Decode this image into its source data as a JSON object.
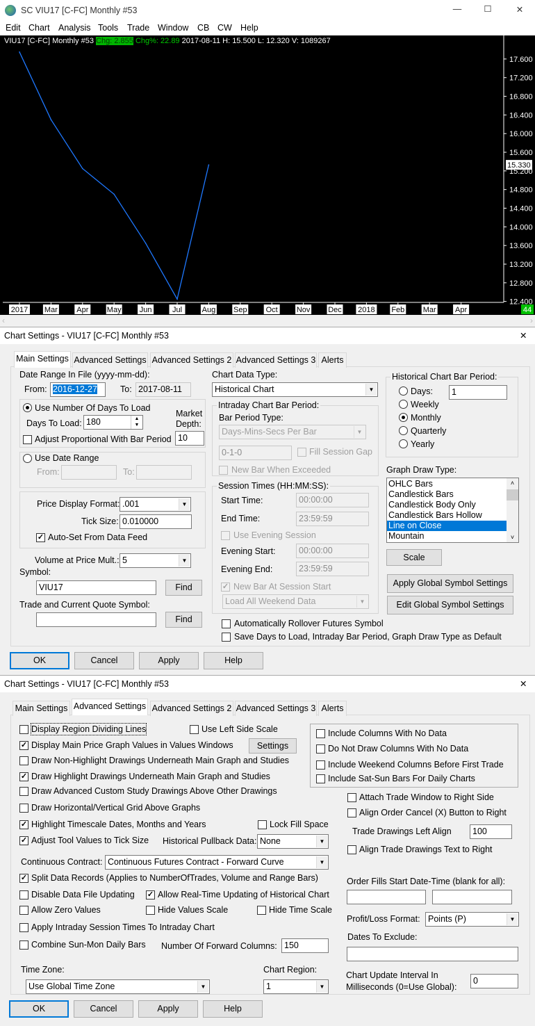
{
  "window": {
    "title": "SC VIU17 [C-FC]  Monthly  #53",
    "min": "—",
    "max": "☐",
    "close": "✕"
  },
  "menu": [
    "Edit",
    "Chart",
    "Analysis",
    "Tools",
    "Trade",
    "Window",
    "CB",
    "CW",
    "Help"
  ],
  "chart_header": {
    "symbol": "VIU17 [C-FC]  Monthly  #53",
    "chg": "Chg: 2.855",
    "chgpct": "Chg%: 22.89",
    "rest": "2017-08-11 H: 15.500 L: 12.320 V: 1089267"
  },
  "chart_data": {
    "type": "line",
    "series_name": "Line on Close",
    "x": [
      "2017",
      "Mar",
      "Apr",
      "May",
      "Jun",
      "Jul",
      "Aug"
    ],
    "values": [
      17.75,
      16.3,
      15.25,
      14.7,
      13.65,
      12.45,
      15.33
    ],
    "x_ticks": [
      "2017",
      "Mar",
      "Apr",
      "May",
      "Jun",
      "Jul",
      "Aug",
      "Sep",
      "Oct",
      "Nov",
      "Dec",
      "2018",
      "Feb",
      "Mar",
      "Apr"
    ],
    "y_ticks": [
      "17.600",
      "17.200",
      "16.800",
      "16.400",
      "16.000",
      "15.600",
      "15.200",
      "14.800",
      "14.400",
      "14.000",
      "13.600",
      "13.200",
      "12.800",
      "12.400"
    ],
    "last_value_label": "15.330",
    "bar_count": "44",
    "ylim": [
      12.38,
      18.09
    ],
    "line_color": "#1e78ff"
  },
  "dialog1": {
    "title": "Chart Settings - VIU17 [C-FC]  Monthly  #53",
    "close": "✕",
    "tabs": [
      "Main Settings",
      "Advanced Settings",
      "Advanced Settings 2",
      "Advanced Settings 3",
      "Alerts"
    ],
    "date_range_label": "Date Range In File (yyyy-mm-dd):",
    "from_label": "From:",
    "from": "2016-12-27",
    "to_label": "To:",
    "to": "2017-08-11",
    "use_days_label": "Use Number Of Days To Load",
    "days_label": "Days To Load:",
    "days": "180",
    "market_depth_label1": "Market",
    "market_depth_label2": "Depth:",
    "market_depth": "10",
    "adjust_prop_label": "Adjust Proportional With Bar Period",
    "use_date_range_label": "Use Date Range",
    "dr_from": "From:",
    "dr_to": "To:",
    "price_format_label": "Price Display Format:",
    "price_format": ".001",
    "tick_size_label": "Tick Size:",
    "tick_size": "0.010000",
    "auto_set_label": "Auto-Set From Data Feed",
    "vap_label": "Volume at Price Mult.:",
    "vap": "5",
    "symbol_label": "Symbol:",
    "symbol": "VIU17",
    "find": "Find",
    "trade_symbol_label": "Trade and Current Quote Symbol:",
    "trade_symbol": "",
    "data_type_label": "Chart Data Type:",
    "data_type": "Historical Chart",
    "intraday_group": "Intraday Chart Bar Period:",
    "bar_period_type_label": "Bar Period Type:",
    "bar_period_type": "Days-Mins-Secs Per Bar",
    "bar_period": "0-1-0",
    "fill_gap": "Fill Session Gap",
    "new_bar_exceeded": "New Bar When Exceeded",
    "session_group": "Session Times (HH:MM:SS):",
    "start_label": "Start Time:",
    "start": "00:00:00",
    "end_label": "End Time:",
    "end": "23:59:59",
    "use_evening": "Use Evening Session",
    "evening_start_label": "Evening Start:",
    "evening_start": "00:00:00",
    "evening_end_label": "Evening End:",
    "evening_end": "23:59:59",
    "new_bar_session": "New Bar At Session Start",
    "weekend": "Load All Weekend Data",
    "rollover": "Automatically Rollover Futures Symbol",
    "save_default": "Save Days to Load, Intraday Bar Period, Graph Draw Type as Default",
    "hist_group": "Historical Chart Bar Period:",
    "periods": [
      "Days:",
      "Weekly",
      "Monthly",
      "Quarterly",
      "Yearly"
    ],
    "days_value": "1",
    "graph_draw_label": "Graph Draw Type:",
    "draw_types": [
      "OHLC Bars",
      "Candlestick Bars",
      "Candlestick Body Only",
      "Candlestick Bars Hollow",
      "Line on Close",
      "Mountain"
    ],
    "scale": "Scale",
    "apply_global": "Apply Global Symbol Settings",
    "edit_global": "Edit Global Symbol Settings",
    "buttons": [
      "OK",
      "Cancel",
      "Apply",
      "Help"
    ]
  },
  "dialog2": {
    "title": "Chart Settings - VIU17 [C-FC]  Monthly  #53",
    "close": "✕",
    "tabs": [
      "Main Settings",
      "Advanced Settings",
      "Advanced Settings 2",
      "Advanced Settings 3",
      "Alerts"
    ],
    "checks": {
      "region_lines": "Display Region Dividing Lines",
      "left_scale": "Use Left Side Scale",
      "main_values": "Display Main Price Graph Values in Values Windows",
      "non_highlight": "Draw Non-Highlight Drawings Underneath Main Graph and Studies",
      "highlight": "Draw Highlight Drawings Underneath Main Graph and Studies",
      "advanced_custom": "Draw Advanced Custom Study Drawings Above Other Drawings",
      "grid_above": "Draw Horizontal/Vertical Grid Above Graphs",
      "highlight_ts": "Highlight Timescale Dates, Months and Years",
      "lock_fill": "Lock Fill Space",
      "adjust_tick": "Adjust Tool Values to Tick Size",
      "split": "Split Data Records (Applies to NumberOfTrades, Volume and Range Bars)",
      "disable_update": "Disable Data File Updating",
      "allow_rt": "Allow Real-Time Updating of Historical Chart",
      "zero": "Allow Zero Values",
      "hide_values": "Hide Values Scale",
      "hide_time": "Hide Time Scale",
      "intraday_session": "Apply Intraday Session Times To Intraday Chart",
      "combine": "Combine Sun-Mon Daily Bars",
      "no_data": "Include Columns With No Data",
      "not_draw": "Do Not Draw Columns With No Data",
      "weekend_cols": "Include Weekend Columns Before First Trade",
      "sat_sun": "Include Sat-Sun Bars For Daily Charts",
      "attach_trade": "Attach Trade Window to Right Side",
      "align_cancel": "Align Order Cancel (X) Button to Right",
      "align_text": "Align Trade Drawings Text to Right"
    },
    "checked": {
      "main_values": true,
      "highlight": true,
      "highlight_ts": true,
      "adjust_tick": true,
      "split": true,
      "allow_rt": true
    },
    "settings": "Settings",
    "pullback_label": "Historical Pullback Data:",
    "pullback": "None",
    "continuous_label": "Continuous Contract:",
    "continuous": "Continuous Futures Contract - Forward Curve",
    "forward_label": "Number Of Forward Columns:",
    "forward": "150",
    "tz_label": "Time Zone:",
    "tz": "Use Global Time Zone",
    "region_label": "Chart Region:",
    "region": "1",
    "trade_left_label": "Trade Drawings Left Align",
    "trade_left": "100",
    "order_fills_label": "Order Fills Start Date-Time (blank for all):",
    "order_fills_1": "",
    "order_fills_2": "",
    "pl_label": "Profit/Loss Format:",
    "pl": "Points (P)",
    "dates_exclude_label": "Dates To Exclude:",
    "dates_exclude": "",
    "interval_label1": "Chart Update Interval In",
    "interval_label2": "Milliseconds (0=Use Global):",
    "interval": "0",
    "buttons": [
      "OK",
      "Cancel",
      "Apply",
      "Help"
    ]
  }
}
